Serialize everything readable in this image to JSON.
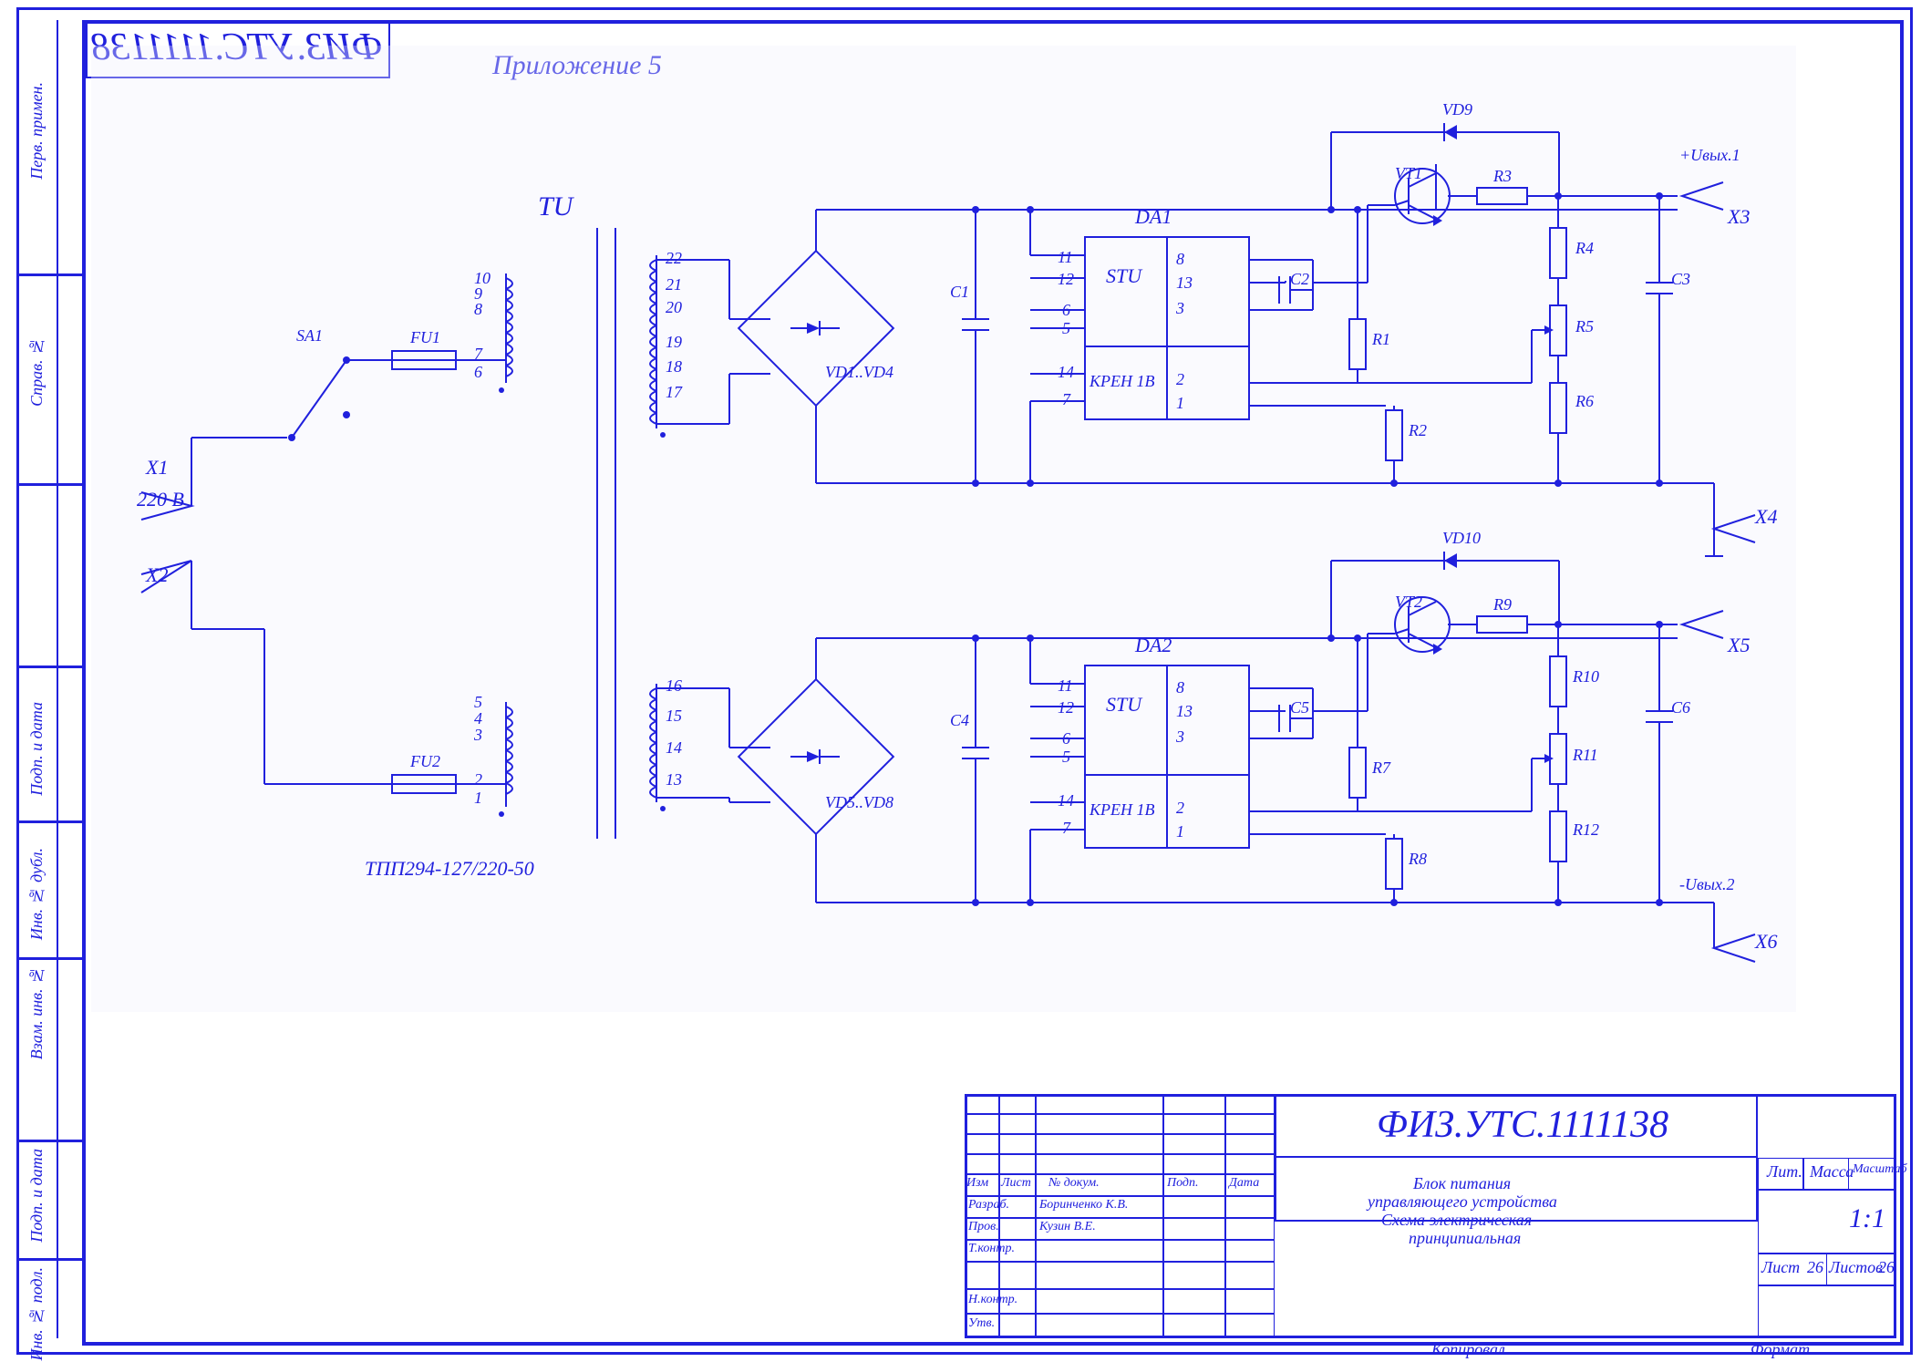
{
  "header": {
    "appendix": "Приложение 5",
    "doc_id": "ФИЗ.УТС.1111138",
    "doc_id_mirror": "ФИЗ.УТС.1111138"
  },
  "side_labels": {
    "l1": "Перв. примен.",
    "l2": "Справ. №",
    "l3": "Подп. и дата",
    "l4": "Инв. № дубл.",
    "l5": "Взам. инв. №",
    "l6": "Подп. и дата",
    "l7": "Инв. № подл."
  },
  "input": {
    "voltage": "220 В",
    "x1": "X1",
    "x2": "X2",
    "sa1": "SA1",
    "fu1": "FU1",
    "fu2": "FU2",
    "tu": "TU",
    "transformer_model": "ТПП294-127/220-50",
    "prim1_pins": [
      "10",
      "9",
      "8",
      "7",
      "6"
    ],
    "prim2_pins": [
      "5",
      "4",
      "3",
      "2",
      "1"
    ],
    "sec1_pins": [
      "22",
      "21",
      "20",
      "19",
      "18",
      "17"
    ],
    "sec2_pins": [
      "16",
      "15",
      "14",
      "13"
    ]
  },
  "rect": {
    "vd1_4": "VD1..VD4",
    "vd5_8": "VD5..VD8",
    "c1": "C1",
    "c4": "C4"
  },
  "da1": {
    "ref": "DA1",
    "type1": "STU",
    "type2": "КРЕН 1В",
    "pins_left": [
      "11",
      "12",
      "6",
      "5",
      "14",
      "7"
    ],
    "pins_right": [
      "8",
      "13",
      "3",
      "2",
      "1"
    ],
    "c2": "C2",
    "r1": "R1",
    "r2": "R2",
    "vd9": "VD9",
    "vt1": "VT1",
    "r3": "R3",
    "r4": "R4",
    "r5": "R5",
    "r6": "R6",
    "c3": "C3",
    "out_label": "+Uвых.1",
    "x3": "X3",
    "x4": "X4"
  },
  "da2": {
    "ref": "DA2",
    "type1": "STU",
    "type2": "КРЕН 1В",
    "pins_left": [
      "11",
      "12",
      "6",
      "5",
      "14",
      "7"
    ],
    "pins_right": [
      "8",
      "13",
      "3",
      "2",
      "1"
    ],
    "c5": "C5",
    "r7": "R7",
    "r8": "R8",
    "vd10": "VD10",
    "vt2": "VT2",
    "r9": "R9",
    "r10": "R10",
    "r11": "R11",
    "r12": "R12",
    "c6": "C6",
    "out_label": "-Uвых.2",
    "x5": "X5",
    "x6": "X6"
  },
  "title_block": {
    "doc_id": "ФИЗ.УТС.1111138",
    "title1": "Блок питания",
    "title2": "управляющего устройства",
    "title3": "Схема электрическая",
    "title4": "принципиальная",
    "h_lit": "Лит.",
    "h_massa": "Масса",
    "h_scale": "Масштаб",
    "scale": "1:1",
    "h_list": "Лист",
    "list_n": "26",
    "h_listov": "Листов",
    "listov_n": "26",
    "rows": {
      "r1c1": "Изм",
      "r1c2": "Лист",
      "r1c3": "№ докум.",
      "r1c4": "Подп.",
      "r1c5": "Дата",
      "r2c1": "Разраб.",
      "r2c3": "Боринченко К.В.",
      "r3c1": "Пров.",
      "r3c3": "Кузин В.Е.",
      "r4c1": "Т.контр.",
      "r5c1": "Н.контр.",
      "r6c1": "Утв."
    },
    "bottom_left": "Копировал",
    "bottom_right": "Формат"
  }
}
